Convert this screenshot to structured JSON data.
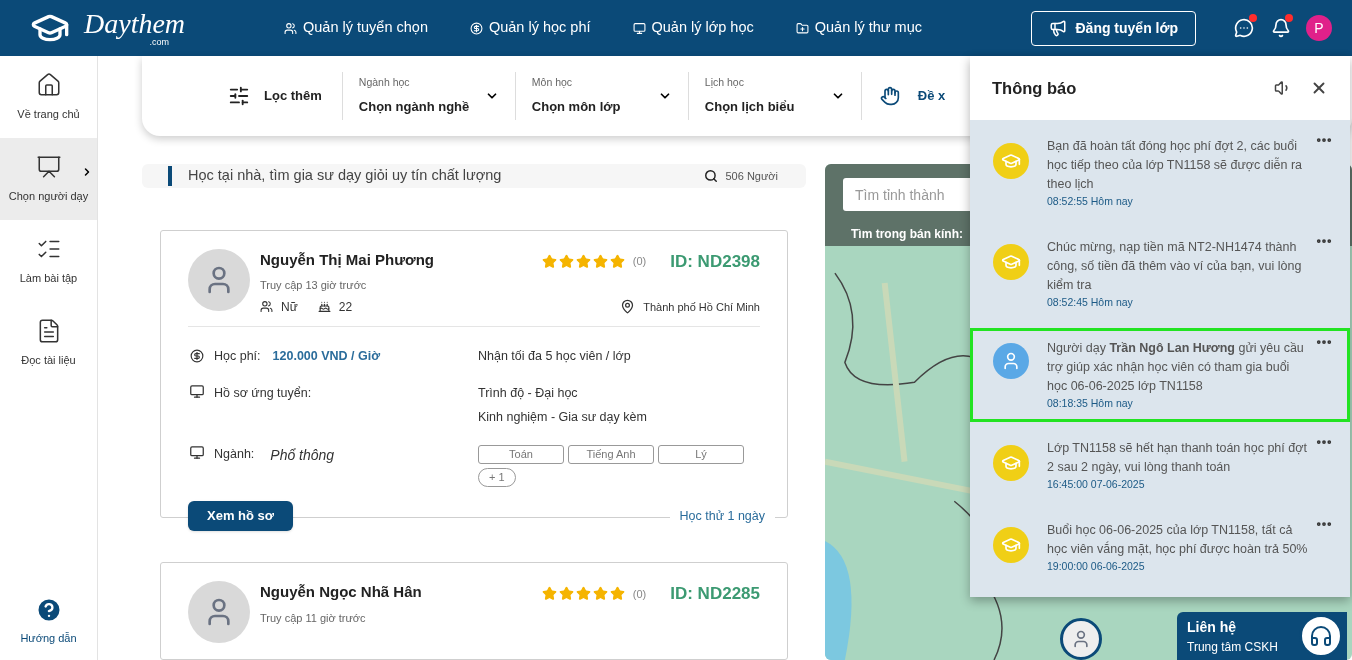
{
  "header": {
    "logo": "Daythem",
    "logo_sub": ".com",
    "nav": [
      {
        "label": "Quản lý tuyển chọn",
        "kind": "people"
      },
      {
        "label": "Quản lý học phí",
        "kind": "money"
      },
      {
        "label": "Quản lý lớp học",
        "kind": "class"
      },
      {
        "label": "Quản lý thư mục",
        "kind": "folder"
      }
    ],
    "post_button": "Đăng tuyển lớp",
    "messages_unread": true,
    "notifications_unread": true,
    "avatar_letter": "P"
  },
  "sidebar": {
    "items": [
      {
        "label": "Về trang chủ",
        "kind": "home",
        "selected": false
      },
      {
        "label": "Chọn người dạy",
        "kind": "tutor",
        "selected": true
      },
      {
        "label": "Làm bài tập",
        "kind": "exercise",
        "selected": false
      },
      {
        "label": "Đọc tài liệu",
        "kind": "document",
        "selected": false
      }
    ],
    "help": "Hướng dẫn"
  },
  "filter_bar": {
    "more_label": "Lọc thêm",
    "dropdowns": [
      {
        "label": "Ngành học",
        "value": "Chọn ngành nghề"
      },
      {
        "label": "Môn học",
        "value": "Chọn môn lớp"
      },
      {
        "label": "Lịch học",
        "value": "Chọn lịch biểu"
      }
    ],
    "suggest_label": "Đề x"
  },
  "search": {
    "placeholder": "Học tại nhà, tìm gia sư dạy giỏi uy tín chất lượng",
    "count": "506 Người"
  },
  "tutors": [
    {
      "name": "Nguyễn Thị Mai Phương",
      "last_access": "Truy cập 13 giờ trước",
      "gender": "Nữ",
      "age": "22",
      "stars": 5,
      "rating_count": "(0)",
      "id": "ID: ND2398",
      "location": "Thành phố Hồ Chí Minh",
      "fee_label": "Học phí:",
      "fee": "120.000 VND / Giờ",
      "capacity": "Nhận tối đa 5 học viên / lớp",
      "profile_label": "Hồ sơ ứng tuyển:",
      "profile_lines": [
        "Trình độ - Đại học",
        "Kinh nghiệm - Gia sư dạy kèm"
      ],
      "field_label": "Ngành:",
      "field": "Phổ thông",
      "subjects": [
        "Toán",
        "Tiếng Anh",
        "Lý"
      ],
      "more_subjects": "+ 1",
      "button": "Xem hồ sơ",
      "trial": "Học thử 1 ngày"
    },
    {
      "name": "Nguyễn Ngọc Nhã Hân",
      "last_access": "Truy cập 11 giờ trước",
      "stars": 5,
      "rating_count": "(0)",
      "id": "ID: ND2285"
    }
  ],
  "map": {
    "search_placeholder": "Tìm tỉnh thành",
    "radius_label": "Tìm trong bán kính:"
  },
  "notifications": {
    "title": "Thông báo",
    "items": [
      {
        "kind": "system",
        "text": "Bạn đã hoàn tất đóng học phí đợt 2, các buổi học tiếp theo của lớp TN1158 sẽ được diễn ra theo lịch",
        "time": "08:52:55 Hôm nay",
        "selected": false
      },
      {
        "kind": "system",
        "text": "Chúc mừng, nạp tiền mã NT2-NH1474 thành công, số tiền đã thêm vào ví của bạn, vui lòng kiểm tra",
        "time": "08:52:45 Hôm nay",
        "selected": false
      },
      {
        "kind": "tutor",
        "text": "Người dạy **Trần Ngô Lan Hương** gửi yêu cầu trợ giúp xác nhận học viên có tham gia buổi học 06-06-2025 lớp TN1158",
        "time": "08:18:35 Hôm nay",
        "selected": true
      },
      {
        "kind": "system",
        "text": "Lớp TN1158 sẽ hết hạn thanh toán học phí đợt 2 sau 2 ngày, vui lòng thanh toán",
        "time": "16:45:00 07-06-2025",
        "selected": false
      },
      {
        "kind": "system",
        "text": "Buổi học 06-06-2025 của lớp TN1158, tất cả học viên vắng mặt, học phí được hoàn trả 50%",
        "time": "19:00:00 06-06-2025",
        "selected": false
      }
    ]
  },
  "contact": {
    "title": "Liên hệ",
    "subtitle": "Trung tâm CSKH"
  }
}
